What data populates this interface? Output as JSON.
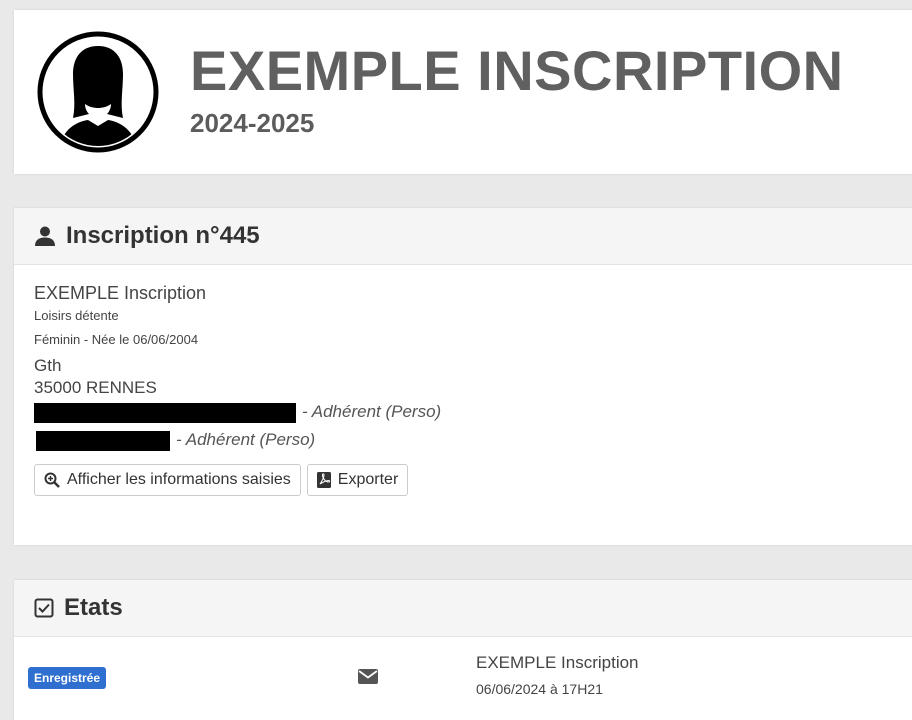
{
  "header": {
    "title": "EXEMPLE INSCRIPTION",
    "subtitle": "2024-2025"
  },
  "inscription": {
    "heading": "Inscription n°445",
    "name": "EXEMPLE Inscription",
    "activity": "Loisirs détente",
    "details": "Féminin - Née le 06/06/2004",
    "address_line1": "Gth",
    "address_line2": "35000 RENNES",
    "contacts": [
      {
        "suffix": "- Adhérent (Perso)"
      },
      {
        "suffix": "- Adhérent (Perso)"
      }
    ],
    "buttons": {
      "show_info": "Afficher les informations saisies",
      "export": "Exporter"
    }
  },
  "etats": {
    "heading": "Etats",
    "rows": [
      {
        "badge": "Enregistrée",
        "name": "EXEMPLE Inscription",
        "date": "06/06/2024 à 17H21"
      }
    ]
  },
  "icons": {
    "avatar": "user-female-silhouette-icon",
    "inscription": "user-icon",
    "etats": "checkbox-icon",
    "show_info": "zoom-icon",
    "export": "pdf-icon",
    "envelope": "envelope-icon"
  },
  "colors": {
    "badge": "#2f6fd0",
    "title": "#606060"
  }
}
